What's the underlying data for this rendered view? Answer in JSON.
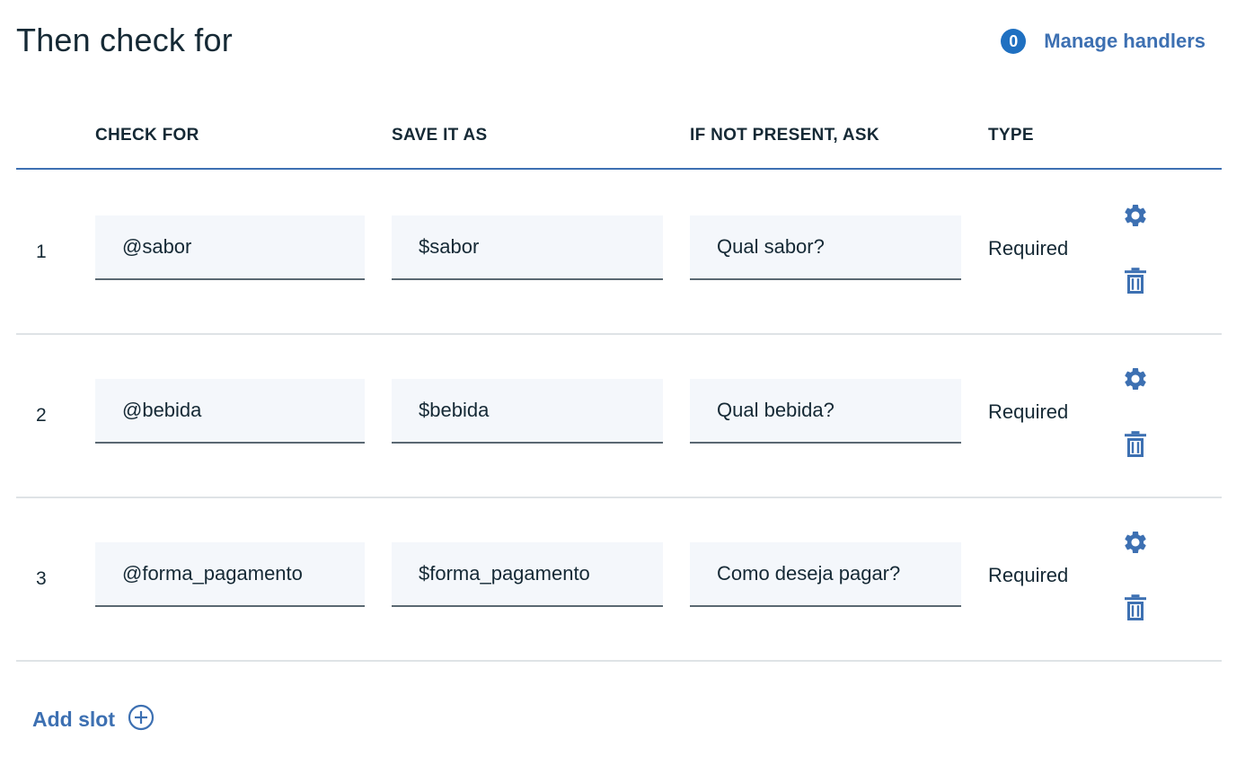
{
  "header": {
    "title": "Then check for",
    "handlers_count": "0",
    "manage_label": "Manage handlers"
  },
  "columns": {
    "check_for": "CHECK FOR",
    "save_as": "SAVE IT AS",
    "ask": "IF NOT PRESENT, ASK",
    "type": "TYPE"
  },
  "slots": [
    {
      "num": "1",
      "check_for": "@sabor",
      "save_as": "$sabor",
      "ask": "Qual sabor?",
      "type": "Required"
    },
    {
      "num": "2",
      "check_for": "@bebida",
      "save_as": "$bebida",
      "ask": "Qual bebida?",
      "type": "Required"
    },
    {
      "num": "3",
      "check_for": "@forma_pagamento",
      "save_as": "$forma_pagamento",
      "ask": "Como deseja pagar?",
      "type": "Required"
    }
  ],
  "footer": {
    "add_slot_label": "Add slot"
  },
  "icons": {
    "row_settings": "gear-icon",
    "row_delete": "trash-icon",
    "add": "plus-circle-icon"
  },
  "colors": {
    "accent": "#3d70b2",
    "badge": "#1f70c1",
    "text": "#152935",
    "field_bg": "#f4f7fb"
  }
}
